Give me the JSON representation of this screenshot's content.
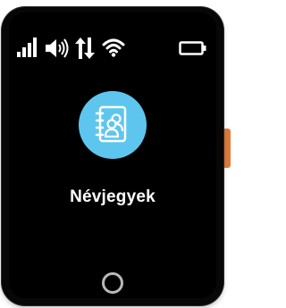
{
  "device": {
    "frame_color": "#070707",
    "screen_color": "#000000",
    "side_button_color": "#e07b39"
  },
  "status_bar": {
    "icons": [
      "signal-bars-icon",
      "volume-icon",
      "data-transfer-icon",
      "wifi-icon",
      "battery-icon"
    ],
    "icon_color": "#ffffff"
  },
  "app": {
    "name": "Névjegyek",
    "icon": "contacts-book-icon",
    "icon_background": "#5ec6ee"
  },
  "navigation": {
    "home_icon": "home-circle-icon"
  }
}
